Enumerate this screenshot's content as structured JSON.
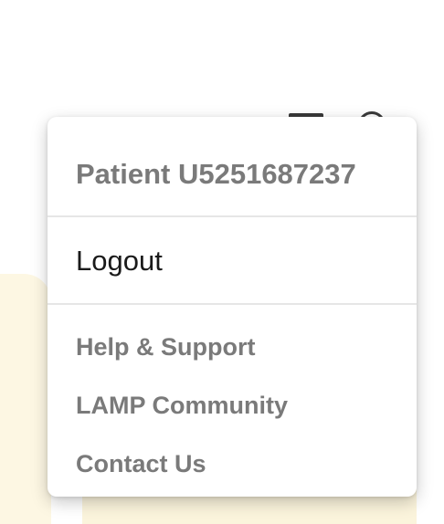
{
  "account_menu": {
    "patient_name": "Patient U5251687237",
    "logout_label": "Logout",
    "links": [
      {
        "label": "Help & Support"
      },
      {
        "label": "LAMP Community"
      },
      {
        "label": "Contact Us"
      }
    ]
  },
  "colors": {
    "muted_text": "#7a7a7a",
    "primary_text": "#1a1a1a",
    "background_card": "#fdf7e3",
    "divider": "#e6e6e6"
  },
  "icons": {
    "header_left": "square-icon",
    "header_right": "profile-circle-icon"
  }
}
